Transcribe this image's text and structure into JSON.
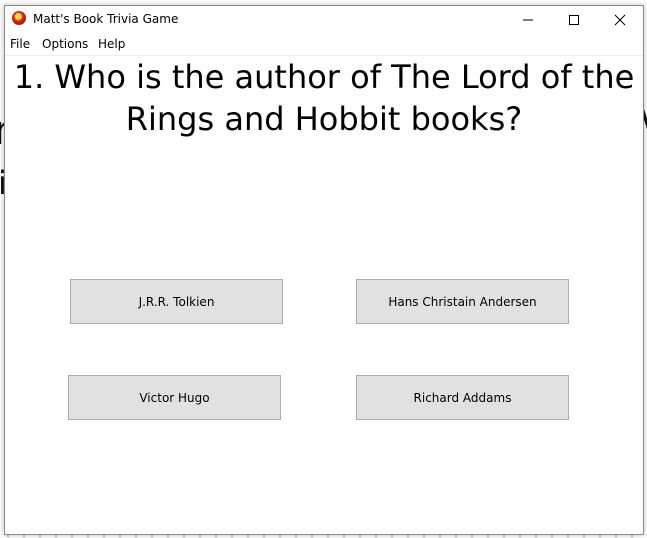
{
  "window": {
    "title": "Matt's Book Trivia Game",
    "icon": "app-game-icon"
  },
  "menu": {
    "file": "File",
    "options": "Options",
    "help": "Help"
  },
  "question": {
    "text": "1. Who is the author of The Lord of the Rings and Hobbit books?"
  },
  "answers": {
    "a": "J.R.R. Tolkien",
    "b": "Hans Christain Andersen",
    "c": "Victor Hugo",
    "d": "Richard Addams"
  },
  "colors": {
    "button_face": "#e1e1e1",
    "button_border": "#adadad",
    "window_border": "#8a8a8a"
  }
}
